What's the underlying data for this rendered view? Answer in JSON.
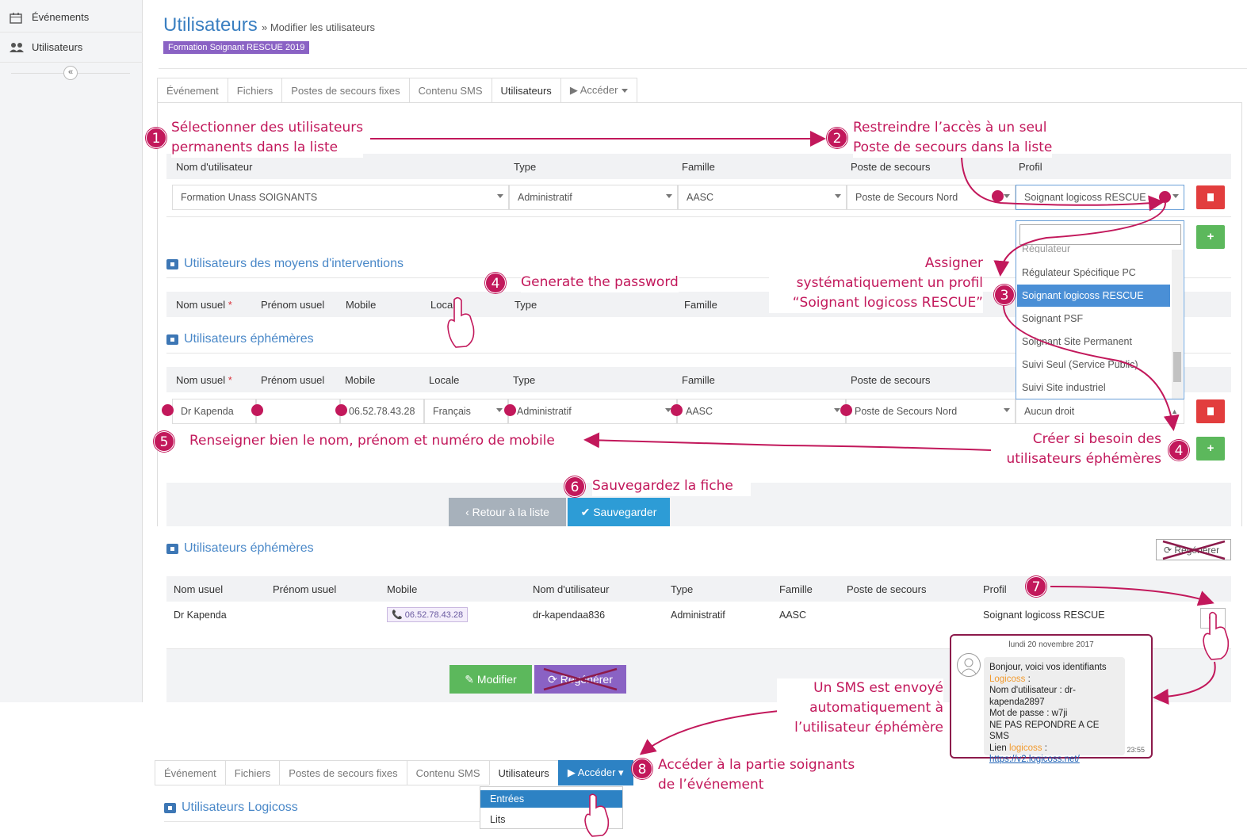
{
  "sidebar": {
    "items": [
      {
        "label": "Événements",
        "icon": "calendar-icon"
      },
      {
        "label": "Utilisateurs",
        "icon": "users-icon"
      }
    ],
    "collapse": "«"
  },
  "header": {
    "title": "Utilisateurs",
    "subtitle": "» Modifier les utilisateurs",
    "event_badge": "Formation Soignant RESCUE 2019"
  },
  "tabs": {
    "items": [
      "Événement",
      "Fichiers",
      "Postes de secours fixes",
      "Contenu SMS",
      "Utilisateurs",
      "▶ Accéder"
    ],
    "active": "Utilisateurs"
  },
  "permanent_users": {
    "columns": [
      "Nom d'utilisateur",
      "Type",
      "Famille",
      "Poste de secours",
      "Profil"
    ],
    "row": {
      "user": "Formation Unass SOIGNANTS",
      "type": "Administratif",
      "famille": "AASC",
      "poste": "Poste de Secours Nord",
      "profil": "Soignant logicoss RESCUE"
    },
    "add_label": "+"
  },
  "profile_dropdown": {
    "items": [
      "Régulateur",
      "Régulateur Spécifique PC",
      "Soignant logicoss RESCUE",
      "Soignant PSF",
      "Soignant Site Permanent",
      "Suivi Seul (Service Public)",
      "Suivi Site industriel"
    ],
    "selected": "Soignant logicoss RESCUE"
  },
  "intervention_users": {
    "title": "Utilisateurs des moyens d'interventions",
    "columns": [
      "Nom usuel",
      "Prénom usuel",
      "Mobile",
      "Locale",
      "Type",
      "Famille"
    ],
    "required_mark": "*"
  },
  "ephemeral_users": {
    "title": "Utilisateurs éphémères",
    "columns": [
      "Nom usuel",
      "Prénom usuel",
      "Mobile",
      "Locale",
      "Type",
      "Famille",
      "Poste de secours"
    ],
    "required_mark": "*",
    "row": {
      "nom": "Dr Kapenda",
      "prenom": "",
      "mobile": "06.52.78.43.28",
      "locale": "Français",
      "type": "Administratif",
      "famille": "AASC",
      "poste": "Poste de Secours Nord",
      "profil": "Aucun droit"
    },
    "add_label": "+"
  },
  "form_buttons": {
    "back": "‹ Retour à la liste",
    "save": "✔ Sauvegarder"
  },
  "saved_view": {
    "title": "Utilisateurs éphémères",
    "regen_top": "⟳ Regénérer",
    "columns": [
      "Nom usuel",
      "Prénom usuel",
      "Mobile",
      "Nom d'utilisateur",
      "Type",
      "Famille",
      "Poste de secours",
      "Profil"
    ],
    "row": {
      "nom": "Dr Kapenda",
      "prenom": "",
      "mobile": "📞 06.52.78.43.28",
      "username": "dr-kapendaa836",
      "type": "Administratif",
      "famille": "AASC",
      "poste": "",
      "profil": "Soignant logicoss RESCUE"
    },
    "modify": "✎ Modifier",
    "regen": "⟳ Regénérer"
  },
  "sms": {
    "date": "lundi 20 novembre 2017",
    "line1": "Bonjour, voici vos identifiants",
    "brand": "Logicoss",
    "brand_suffix": " :",
    "line3": "Nom d'utilisateur : dr-kapenda2897",
    "line4": "Mot de passe : w7ji",
    "line5": "NE PAS REPONDRE A CE SMS",
    "line6_prefix": "Lien ",
    "line6_brand": "logicoss",
    "line6_suffix": " :",
    "link": "https://v2.logicoss.net/",
    "time": "23:55"
  },
  "bottom_tabs": {
    "items": [
      "Événement",
      "Fichiers",
      "Postes de secours fixes",
      "Contenu SMS",
      "Utilisateurs",
      "▶ Accéder ▾"
    ],
    "menu": [
      "Entrées",
      "Lits"
    ],
    "section_title": "Utilisateurs Logicoss"
  },
  "annotations": {
    "a1": "Sélectionner des utilisateurs\npermanents dans la liste",
    "a2": "Restreindre l’accès à un seul\nPoste de secours dans la liste",
    "a3": "Assigner\nsystématiquement un profil\n“Soignant logicoss RESCUE”",
    "a4a": "Generate the password",
    "a4b": "Créer si besoin des\nutilisateurs éphémères",
    "a5": "Renseigner bien le nom, prénom et numéro de mobile",
    "a6": "Sauvegardez la fiche",
    "a7sms": "Un SMS est envoyé\nautomatiquement à\nl’utilisateur éphémère",
    "a8": "Accéder à la partie soignants\nde l’événement",
    "n1": "1",
    "n2": "2",
    "n3": "3",
    "n4": "4",
    "n5": "5",
    "n6": "6",
    "n7": "7",
    "n8": "8"
  },
  "colors": {
    "accent": "#c2185b",
    "brand_blue": "#3a7fc1",
    "badge_purple": "#8a62c4",
    "primary": "#2d9cd6",
    "green": "#5cb85c",
    "danger": "#e23d3d"
  }
}
